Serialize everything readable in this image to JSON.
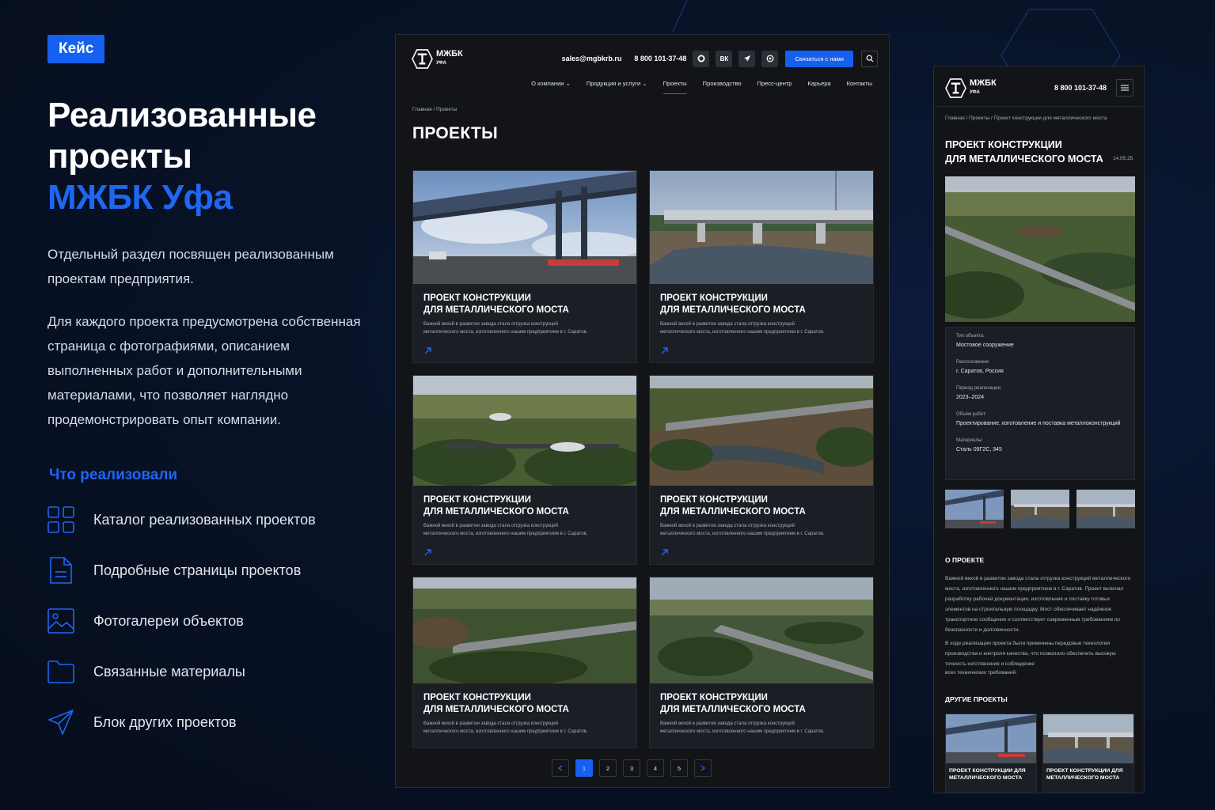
{
  "left": {
    "tag": "Кейс",
    "title_line1": "Реализованные",
    "title_line2": "проекты",
    "title_accent": "МЖБК Уфа",
    "paragraph1": "Отдельный раздел посвящен реализованным проектам предприятия.",
    "paragraph2": "Для каждого проекта предусмотрена собственная страница с фотографиями, описанием выполненных работ и дополнительными материалами, что позволяет наглядно продемонстрировать опыт компании.",
    "features_heading": "Что реализовали",
    "features": [
      {
        "icon": "grid-icon",
        "label": "Каталог реализованных проектов"
      },
      {
        "icon": "document-icon",
        "label": "Подробные страницы проектов"
      },
      {
        "icon": "image-icon",
        "label": "Фотогалереи объектов"
      },
      {
        "icon": "folder-icon",
        "label": "Связанные материалы"
      },
      {
        "icon": "send-icon",
        "label": "Блок других проектов"
      }
    ]
  },
  "brand": {
    "name": "МЖБК",
    "sub": "УФА",
    "accent": "#1560ee"
  },
  "desktop": {
    "email": "sales@mgbkrb.ru",
    "phone": "8 800 101-37-48",
    "social": [
      "max-icon",
      "ВК",
      "telegram-icon",
      "whatsapp-icon"
    ],
    "vk_label": "ВК",
    "cta": "Связаться с нами",
    "nav": [
      "О компании",
      "Продукция и услуги",
      "Проекты",
      "Производство",
      "Пресс-центр",
      "Карьера",
      "Контакты"
    ],
    "breadcrumb": "Главная  /  Проекты",
    "heading": "ПРОЕКТЫ",
    "card_title_1": "Проект конструкции",
    "card_title_2": "для металлического моста",
    "card_desc_1": "Важной вехой в развитии завода стала отгрузка конструкций",
    "card_desc_2": "металлического моста, изготовленного нашим предприятием в г. Саратов.",
    "pages": [
      "1",
      "2",
      "3",
      "4",
      "5"
    ]
  },
  "mobile": {
    "phone": "8 800 101-37-48",
    "breadcrumb": "Главная  /  Проекты  /  Проект конструкции для металлического моста",
    "title_1": "Проект конструкции",
    "title_2": "для металлического моста",
    "date": "14.05.25",
    "specs": [
      {
        "k": "Тип объекта:",
        "v": "Мостовое сооружение"
      },
      {
        "k": "Расположение:",
        "v": "г. Саратов, Россия"
      },
      {
        "k": "Период реализации:",
        "v": "2023–2024"
      },
      {
        "k": "Объём работ:",
        "v": "Проектирование, изготовление и поставка металлоконструкций"
      },
      {
        "k": "Материалы:",
        "v": "Сталь 09Г2С, 345"
      }
    ],
    "about_heading": "О проекте",
    "about_p1": "Важной вехой в развитии завода стала отгрузка конструкций металлического моста, изготовленного нашим предприятием в г. Саратов. Проект включал разработку рабочей документации, изготовление и поставку готовых элементов на строительную площадку. Мост обеспечивает надёжное транспортное сообщение и соответствует современным требованиям по безопасности и долговечности.",
    "about_p2": "В ходе реализации проекта были применены передовые технологии производства и контроля качества, что позволило обеспечить высокую точность изготовления и соблюдение",
    "about_p3": "всех технических требований.",
    "other_heading": "Другие проекты",
    "other_title": "Проект конструкции для металлического моста"
  }
}
